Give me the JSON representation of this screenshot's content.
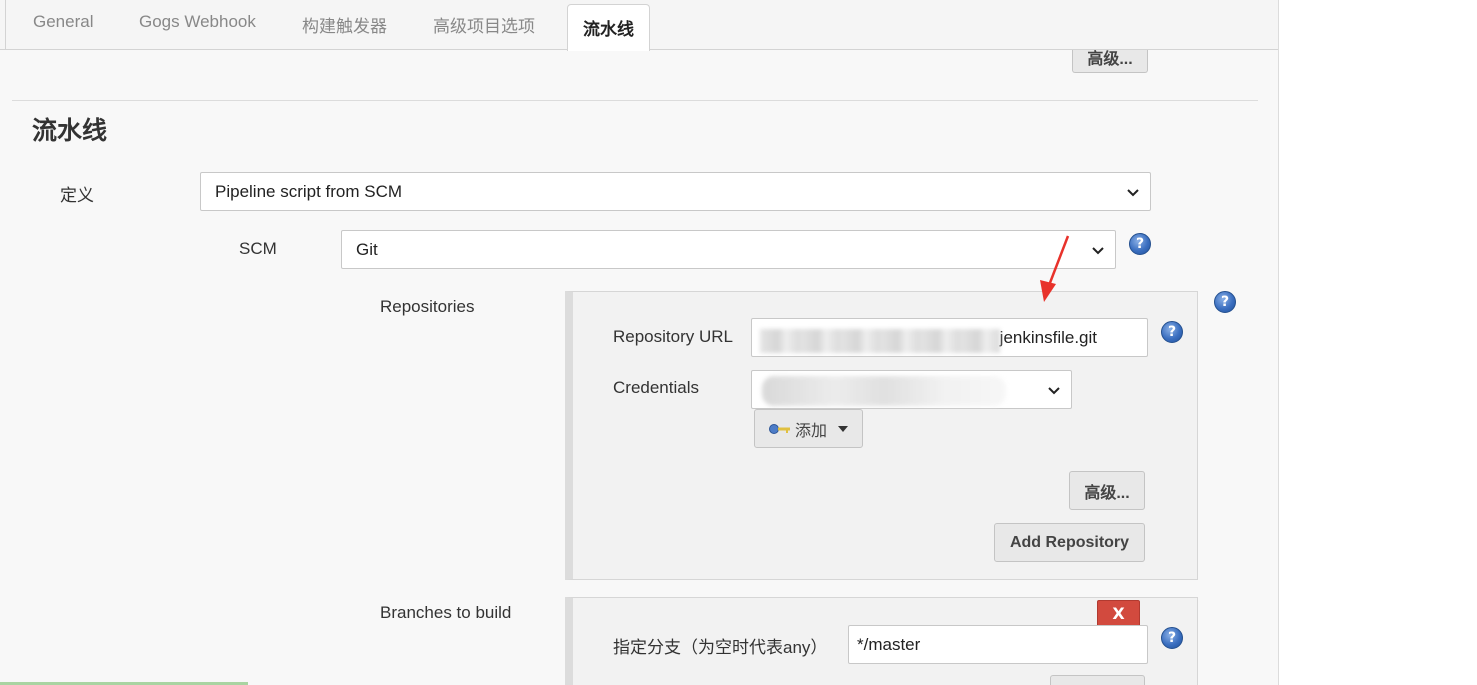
{
  "tabs": [
    {
      "label": "General"
    },
    {
      "label": "Gogs Webhook"
    },
    {
      "label": "构建触发器"
    },
    {
      "label": "高级项目选项"
    },
    {
      "label": "流水线"
    }
  ],
  "top_advanced_label": "高级...",
  "section_title": "流水线",
  "definition": {
    "label": "定义",
    "value": "Pipeline script from SCM"
  },
  "scm": {
    "label": "SCM",
    "value": "Git"
  },
  "repositories": {
    "label": "Repositories",
    "url_label": "Repository URL",
    "url_value": "jenkinsfile.git",
    "credentials_label": "Credentials",
    "add_label": "添加",
    "advanced_label": "高级...",
    "add_repo_label": "Add Repository"
  },
  "branches": {
    "label": "Branches to build",
    "remove_label": "X",
    "spec_label": "指定分支（为空时代表any）",
    "spec_value": "*/master"
  },
  "colors": {
    "annotation_arrow": "#e8322b",
    "remove_button": "#d24a3e",
    "help_icon": "#3b6fc0"
  }
}
